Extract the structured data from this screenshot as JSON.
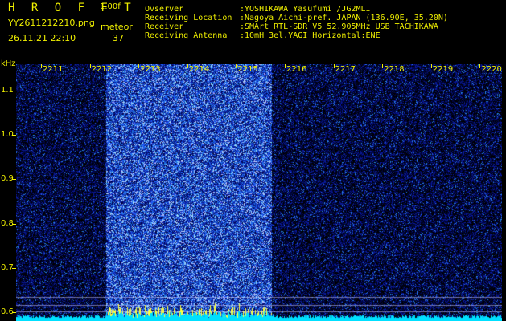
{
  "header": {
    "brand": "H R O F F T",
    "version": "1.00f",
    "filename": "YY2611212210.png",
    "meteor_label": "meteor",
    "datetime": "26.11.21 22:10",
    "meteor_count": "37"
  },
  "station": [
    {
      "key": "Ovserver",
      "value": ":YOSHIKAWA Yasufumi /JG2MLI"
    },
    {
      "key": "Receiving Location",
      "value": ":Nagoya Aichi-pref. JAPAN (136.90E, 35.20N)"
    },
    {
      "key": "Receiver",
      "value": ":SMArt RTL-SDR V5 52.905MHz USB TACHIKAWA"
    },
    {
      "key": "Receiving Antenna",
      "value": ":10mH 3el.YAGI Horizontal:ENE"
    }
  ],
  "colors": {
    "labels": "#f0f000",
    "background": "#000000",
    "signal": "#2040ff",
    "baseline": "#00e0ff",
    "meteor_spike": "#ffff40"
  },
  "chart_data": {
    "type": "heatmap",
    "ylabel": "kHz",
    "x_ticks": [
      "2211",
      "2212",
      "2213",
      "2214",
      "2215",
      "2216",
      "2217",
      "2218",
      "2219",
      "2220"
    ],
    "y_ticks": [
      "1.1",
      "1.0",
      "0.9",
      "0.8",
      "0.7",
      "0.6"
    ],
    "x_range": [
      2211,
      2220
    ],
    "y_range": [
      0.58,
      1.16
    ],
    "meteor_echo_span": [
      2212.3,
      2215.7
    ],
    "grid": false
  }
}
